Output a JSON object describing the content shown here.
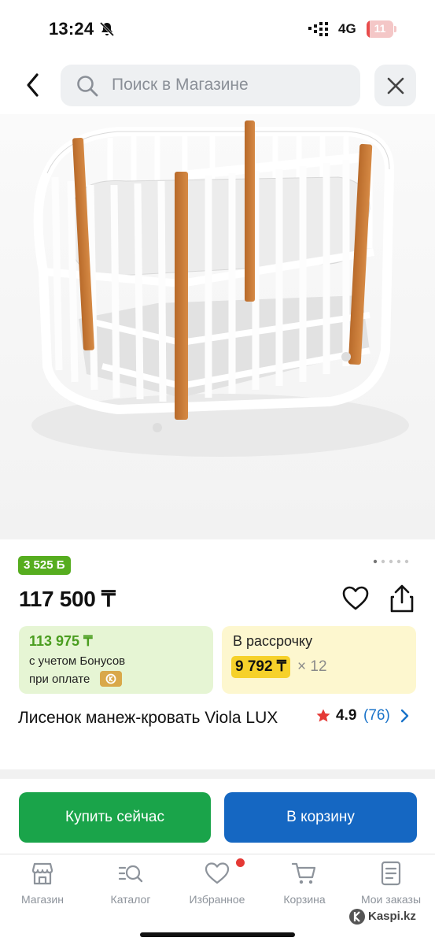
{
  "status_bar": {
    "time": "13:24",
    "network": "4G",
    "battery": "11",
    "battery_level_percent": 11,
    "icons": [
      "bell-off-icon",
      "signal-icon",
      "battery-icon"
    ]
  },
  "header": {
    "search_placeholder": "Поиск в Магазине",
    "icons": [
      "back-arrow-icon",
      "search-icon",
      "close-icon"
    ]
  },
  "gallery": {
    "total_images": 5,
    "active_index": 0,
    "image_subject": "white oval crib with wooden posts"
  },
  "product": {
    "bonus_badge": "3 525 Б",
    "price": "117 500 ₸",
    "bonus_card": {
      "price": "113 975 ₸",
      "line1": "с учетом Бонусов",
      "line2": "при оплате"
    },
    "installment_card": {
      "title": "В рассрочку",
      "monthly": "9 792 ₸",
      "multiplier": "× 12"
    },
    "title": "Лисенок манеж-кровать Viola LUX",
    "rating": "4.9",
    "reviews": "(76)"
  },
  "actions": {
    "buy_now": "Купить сейчас",
    "add_to_cart": "В корзину"
  },
  "tab_bar": {
    "items": [
      {
        "label": "Магазин",
        "icon": "store-icon"
      },
      {
        "label": "Каталог",
        "icon": "catalog-search-icon"
      },
      {
        "label": "Избранное",
        "icon": "heart-icon"
      },
      {
        "label": "Корзина",
        "icon": "cart-icon"
      },
      {
        "label": "Мои заказы",
        "icon": "orders-icon"
      }
    ]
  },
  "watermark": "Kaspi.kz",
  "colors": {
    "green": "#1aa44a",
    "blue": "#1567c2",
    "bonus_green": "#56ad1f",
    "installment_yellow": "#f6d12a",
    "red": "#e53935"
  }
}
